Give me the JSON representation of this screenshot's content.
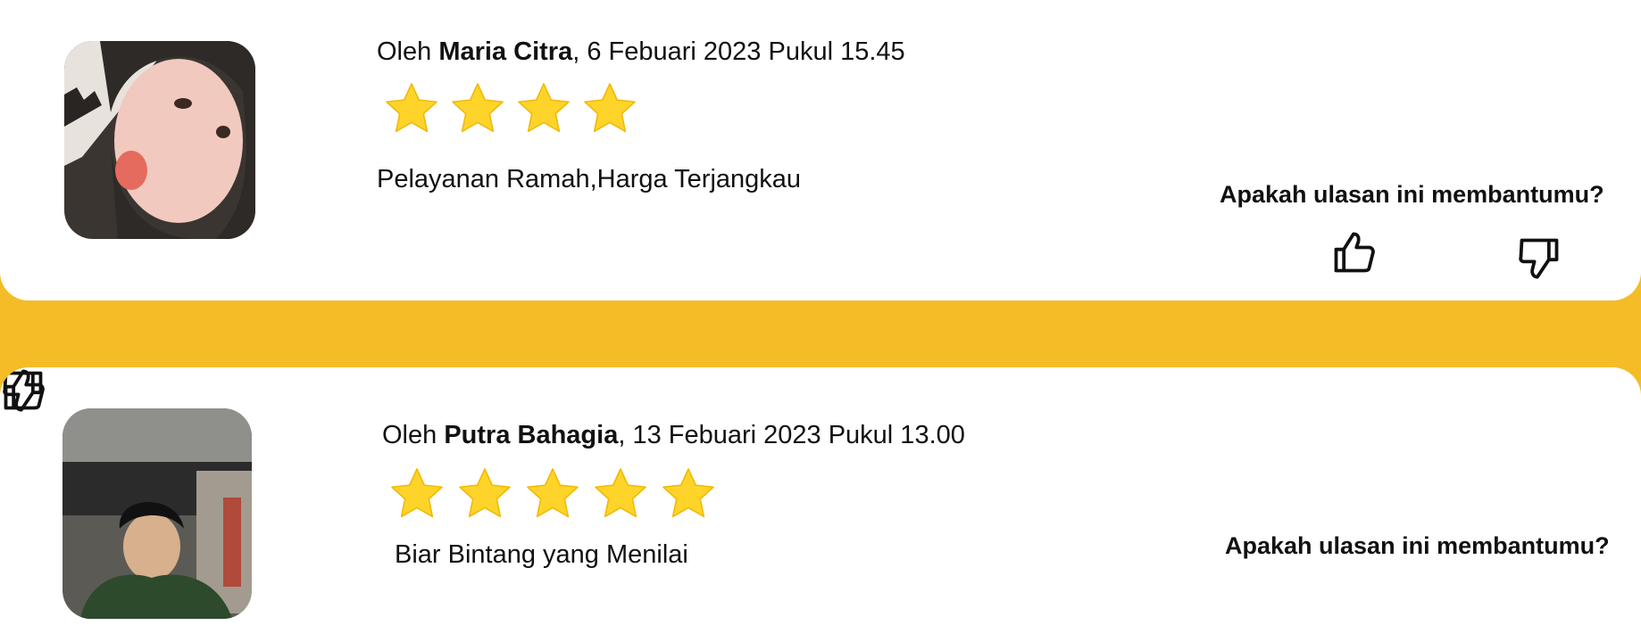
{
  "reviews": [
    {
      "prefix": "Oleh ",
      "name": "Maria Citra",
      "date_text": ", 6 Febuari 2023 Pukul 15.45",
      "rating": 4,
      "text": "Pelayanan Ramah,Harga Terjangkau",
      "helpful_question": "Apakah ulasan ini membantumu?",
      "avatar_icon": "avatar-photo",
      "like_icon": "thumbs-up-icon",
      "dislike_icon": "thumbs-down-icon"
    },
    {
      "prefix": "Oleh ",
      "name": "Putra Bahagia",
      "date_text": ", 13 Febuari 2023 Pukul 13.00",
      "rating": 5,
      "text": "Biar Bintang yang Menilai",
      "helpful_question": "Apakah ulasan ini membantumu?",
      "avatar_icon": "avatar-photo",
      "like_icon": "thumbs-up-icon",
      "dislike_icon": "thumbs-down-icon"
    }
  ],
  "colors": {
    "background": "#F4BC27",
    "card": "#FFFFFF",
    "star": "#FFD42A",
    "text": "#111111"
  }
}
